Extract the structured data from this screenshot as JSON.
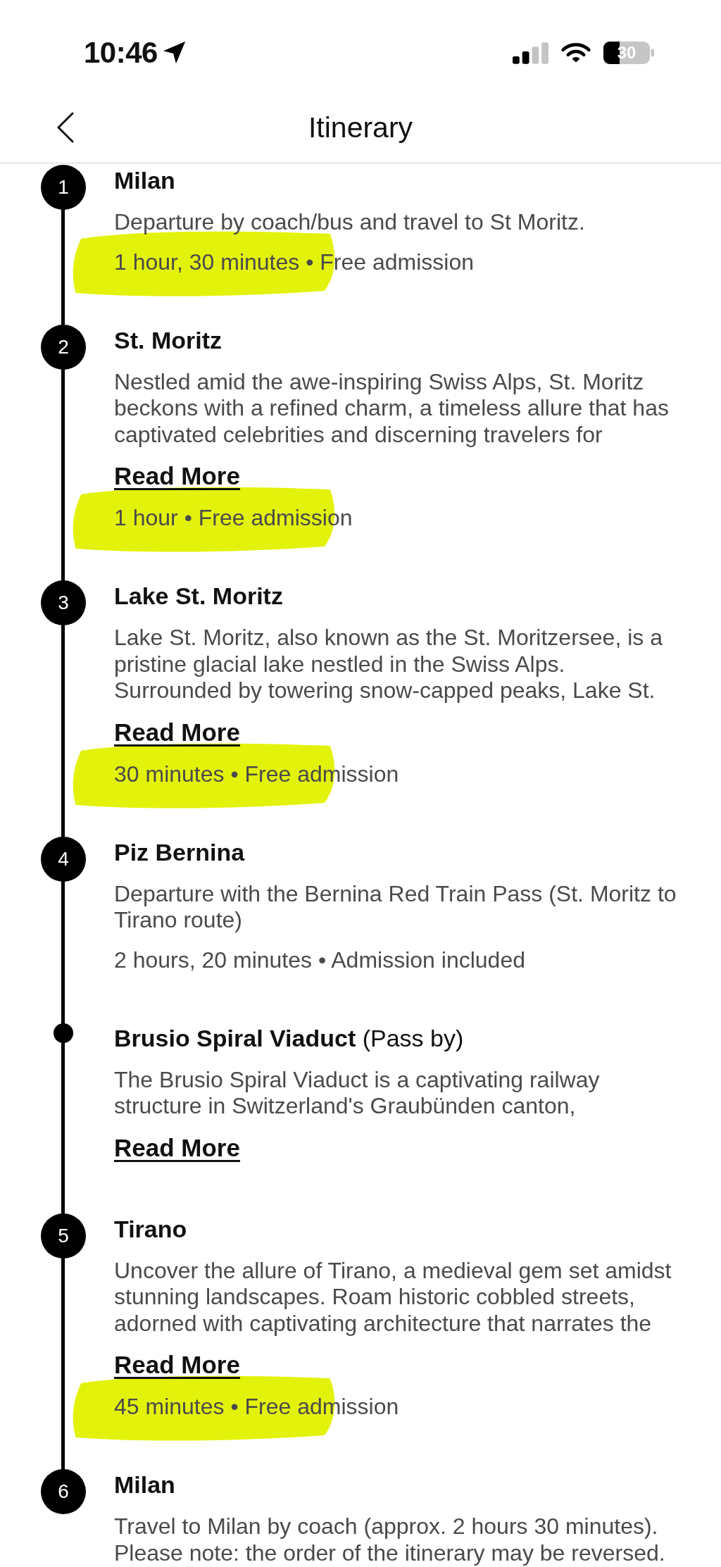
{
  "status_bar": {
    "time": "10:46",
    "battery": "30"
  },
  "header": {
    "title": "Itinerary"
  },
  "stops": [
    {
      "kind": "numbered",
      "number": "1",
      "title": "Milan",
      "description": "Departure by coach/bus and travel to St Moritz.",
      "meta": "1 hour, 30 minutes • Free admission",
      "highlighted": true
    },
    {
      "kind": "numbered",
      "number": "2",
      "title": "St. Moritz",
      "description": "Nestled amid the awe-inspiring Swiss Alps, St. Moritz beckons with a refined charm, a timeless allure that has captivated celebrities and discerning travelers for",
      "read_more": "Read More",
      "meta": "1 hour • Free admission",
      "highlighted": true
    },
    {
      "kind": "numbered",
      "number": "3",
      "title": "Lake St. Moritz",
      "description": "Lake St. Moritz, also known as the St. Moritzersee, is a pristine glacial lake nestled in the Swiss Alps. Surrounded by towering snow-capped peaks, Lake St.",
      "read_more": "Read More",
      "meta": "30 minutes • Free admission",
      "highlighted": true
    },
    {
      "kind": "numbered",
      "number": "4",
      "title": "Piz Bernina",
      "description": "Departure with the Bernina Red Train Pass (St. Moritz to Tirano route)",
      "meta": "2 hours, 20 minutes • Admission included",
      "highlighted": false
    },
    {
      "kind": "pass_by",
      "title": "Brusio Spiral Viaduct",
      "title_note": "(Pass by)",
      "description": "The Brusio Spiral Viaduct is a captivating railway structure in Switzerland's Graubünden canton,",
      "read_more": "Read More",
      "highlighted": false
    },
    {
      "kind": "numbered",
      "number": "5",
      "title": "Tirano",
      "description": "Uncover the allure of Tirano, a medieval gem set amidst stunning landscapes. Roam historic cobbled streets, adorned with captivating architecture that narrates the",
      "read_more": "Read More",
      "meta": "45 minutes • Free admission",
      "highlighted": true
    },
    {
      "kind": "numbered",
      "number": "6",
      "title": "Milan",
      "description": "Travel to Milan by coach (approx. 2 hours 30 minutes). Please note: the order of the itinerary may be reversed.",
      "highlighted": false
    }
  ]
}
